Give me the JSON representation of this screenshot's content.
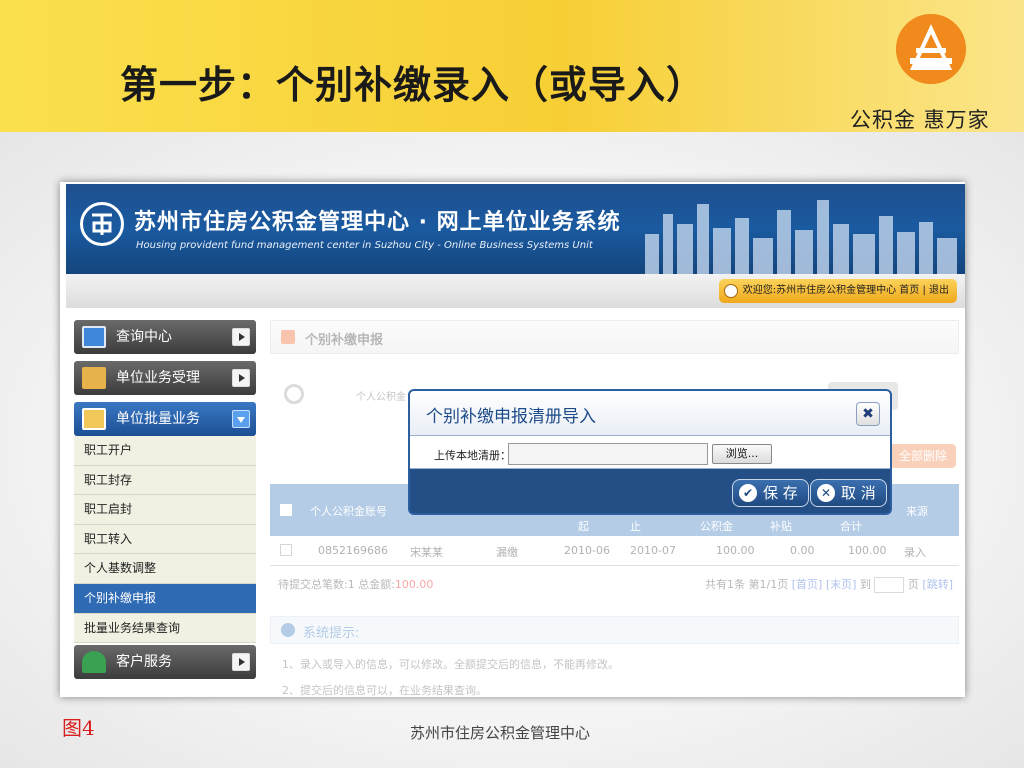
{
  "slide": {
    "title": "第一步：个别补缴录入（或导入）",
    "slogan": "公积金  惠万家",
    "figure_label": "图4",
    "footer": "苏州市住房公积金管理中心"
  },
  "banner": {
    "title": "苏州市住房公积金管理中心 · 网上单位业务系统",
    "subtitle": "Housing provident fund management center in Suzhou City - Online Business Systems Unit"
  },
  "topbar": {
    "welcome": "欢迎您:苏州市住房公积金管理中心 首页 | 退出"
  },
  "sidebar": {
    "items": [
      {
        "label": "查询中心"
      },
      {
        "label": "单位业务受理"
      },
      {
        "label": "单位批量业务"
      },
      {
        "label": "客户服务"
      }
    ],
    "sub_items": [
      "职工开户",
      "职工封存",
      "职工启封",
      "职工转入",
      "个人基数调整",
      "个别补缴申报",
      "批量业务结果查询"
    ],
    "selected_sub": "个别补缴申报"
  },
  "main": {
    "breadcrumb": "个别补缴申报",
    "search_label": "个人公积金",
    "delete_all": "全部删除",
    "table": {
      "headers": [
        "个人公积金账号",
        "起",
        "止",
        "公积金",
        "补贴",
        "合计",
        "来源"
      ],
      "row": [
        "0852169686",
        "宋某某",
        "漏缴",
        "2010-06",
        "2010-07",
        "100.00",
        "0.00",
        "100.00",
        "录入"
      ]
    },
    "summary_prefix": "待提交总笔数:1  总金额:",
    "summary_amount": "100.00",
    "pager": {
      "text": "共有1条 第1/1页",
      "first": "[首页]",
      "last": "[末页]",
      "goto": "到",
      "page": "页",
      "jump": "[跳转]"
    },
    "tips_title": "系统提示:",
    "tip1": "1、录入或导入的信息，可以修改。全额提交后的信息，不能再修改。",
    "tip2": "2、提交后的信息可以，在业务结果查询。"
  },
  "dialog": {
    "title": "个别补缴申报清册导入",
    "close": "✖",
    "upload_label": "上传本地清册：",
    "browse": "浏览...",
    "save": "保 存",
    "cancel": "取 消"
  },
  "colors": {
    "header_yellow": "#f7cf35",
    "banner_blue": "#1a5aa0",
    "dialog_blue": "#234f86",
    "selected_blue": "#2f6bb5",
    "figure_red": "#d81e1e"
  }
}
